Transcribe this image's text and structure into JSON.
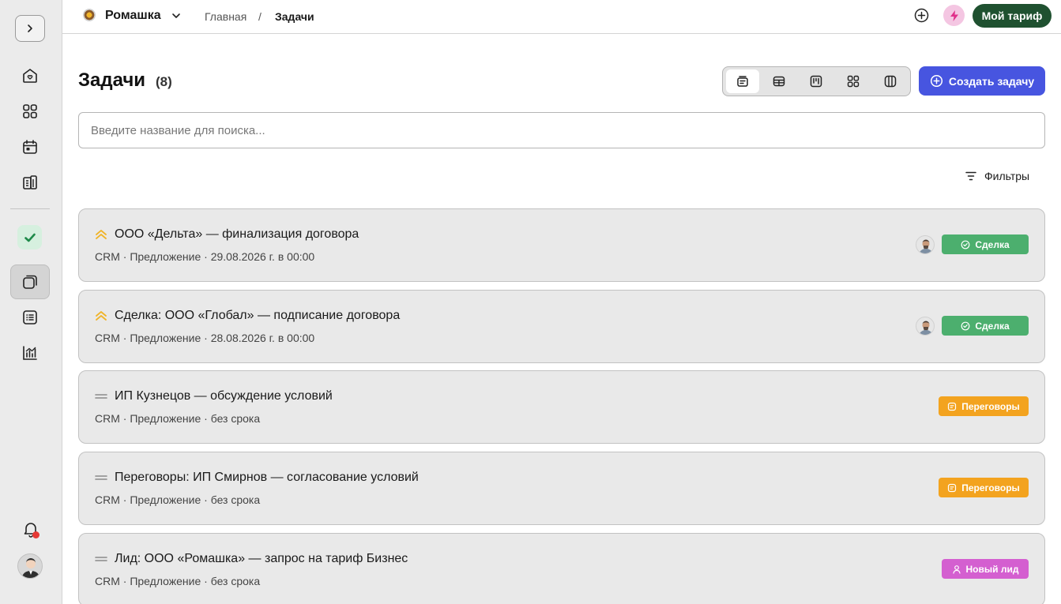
{
  "sidebar": {
    "toggle_icon": "chevron-right-icon",
    "nav_icons": [
      "home-icon",
      "grid-icon",
      "calendar-icon",
      "building-icon",
      "check-icon",
      "notes-icon",
      "list-icon",
      "analytics-icon"
    ],
    "notification_icon": "bell-icon",
    "user_avatar": "avatar"
  },
  "topbar": {
    "workspace_name": "Ромашка",
    "breadcrumb": {
      "home": "Главная",
      "separator": "/",
      "current": "Задачи"
    },
    "plan_button": "Мой тариф"
  },
  "header": {
    "title": "Задачи",
    "count": "(8)",
    "view_modes": [
      "cards-view-icon",
      "table-view-icon",
      "kanban-view-icon",
      "grid-view-icon",
      "columns-view-icon"
    ],
    "active_view": "cards",
    "create_button": "Создать задачу"
  },
  "search": {
    "placeholder": "Введите название для поиска...",
    "value": ""
  },
  "filters_label": "Фильтры",
  "tasks": [
    {
      "title": "ООО «Дельта» — финализация договора",
      "meta": "CRM · Предложение · 29.08.2026 г. в 00:00",
      "priority": "high",
      "status": "Сделка",
      "has_avatar": true
    },
    {
      "title": "Сделка: ООО «Глобал» — подписание договора",
      "meta": "CRM · Предложение · 28.08.2026 г. в 00:00",
      "priority": "high",
      "status": "Сделка",
      "has_avatar": true
    },
    {
      "title": "ИП Кузнецов — обсуждение условий",
      "meta": "CRM · Предложение · без срока",
      "priority": "medium",
      "status": "Переговоры",
      "has_avatar": false
    },
    {
      "title": "Переговоры: ИП Смирнов — согласование условий",
      "meta": "CRM · Предложение · без срока",
      "priority": "medium",
      "status": "Переговоры",
      "has_avatar": false
    },
    {
      "title": "Лид: ООО «Ромашка» — запрос на тариф Бизнес",
      "meta": "CRM · Предложение · без срока",
      "priority": "medium",
      "status": "Новый лид",
      "has_avatar": false
    }
  ],
  "colors": {
    "accent": "#4755e0",
    "plan": "#1f5130",
    "status_deal": "#4caf6e",
    "status_negotiation": "#f3a31f",
    "status_lead": "#d45fd0",
    "priority_high": "#f0b429"
  }
}
